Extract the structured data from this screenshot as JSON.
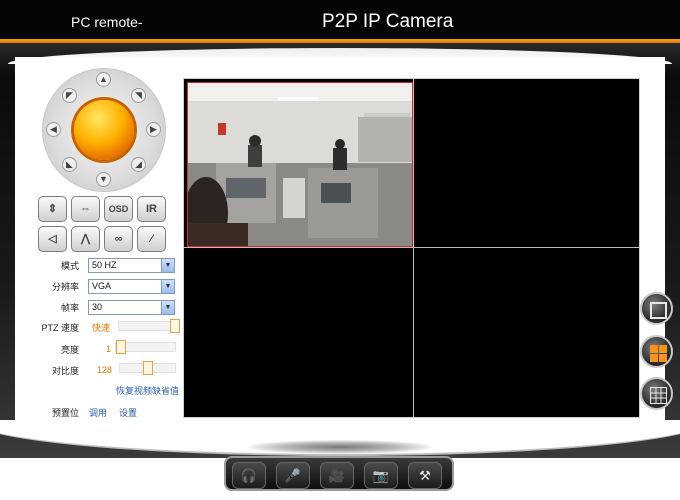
{
  "header": {
    "brand": "PC remote-",
    "title": "P2P IP Camera"
  },
  "controls": {
    "buttons": [
      {
        "name": "vertical-flip-button",
        "glyph": "⇕"
      },
      {
        "name": "horizontal-flip-button",
        "glyph": "⇔"
      },
      {
        "name": "osd-button",
        "glyph": "OSD"
      },
      {
        "name": "ir-button",
        "glyph": "IR"
      },
      {
        "name": "left-patrol-button",
        "glyph": "◁"
      },
      {
        "name": "up-patrol-button",
        "glyph": "⋀"
      },
      {
        "name": "cruise-button",
        "glyph": "∞"
      },
      {
        "name": "stop-button",
        "glyph": "⁄"
      }
    ]
  },
  "settings": {
    "mode_label": "模式",
    "mode_value": "50 HZ",
    "resolution_label": "分辨率",
    "resolution_value": "VGA",
    "fps_label": "帧率",
    "fps_value": "30",
    "ptz_label": "PTZ 速度",
    "ptz_value": "快速",
    "ptz_level": 1.0,
    "brightness_label": "亮度",
    "brightness_value": "1",
    "contrast_label": "对比度",
    "contrast_value": "128",
    "restore_default": "恢复视频缺省值",
    "preset_label": "预置位",
    "preset_call": "调用",
    "preset_set": "设置"
  },
  "view_modes": [
    "single-view",
    "quad-view",
    "nine-view"
  ],
  "toolbar": [
    "headphone-icon",
    "microphone-icon",
    "record-icon",
    "snapshot-icon",
    "settings-icon"
  ]
}
